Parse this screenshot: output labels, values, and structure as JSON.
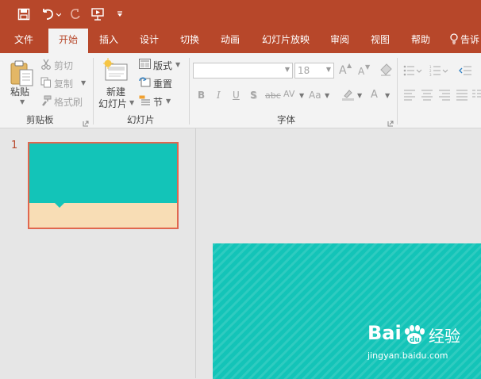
{
  "qat": {
    "save_icon": "save-icon",
    "undo_icon": "undo-icon",
    "redo_icon": "redo-icon",
    "present_icon": "start-slideshow-icon",
    "customize_icon": "customize-qat-icon"
  },
  "tabs": [
    {
      "label": "文件",
      "active": false
    },
    {
      "label": "开始",
      "active": true
    },
    {
      "label": "插入",
      "active": false
    },
    {
      "label": "设计",
      "active": false
    },
    {
      "label": "切换",
      "active": false
    },
    {
      "label": "动画",
      "active": false
    },
    {
      "label": "幻灯片放映",
      "active": false
    },
    {
      "label": "审阅",
      "active": false
    },
    {
      "label": "视图",
      "active": false
    },
    {
      "label": "帮助",
      "active": false
    }
  ],
  "tell_me": "告诉",
  "ribbon": {
    "clipboard": {
      "paste": "粘贴",
      "cut": "剪切",
      "copy": "复制",
      "format_painter": "格式刷",
      "group_label": "剪贴板"
    },
    "slides": {
      "new_slide_line1": "新建",
      "new_slide_line2": "幻灯片",
      "layout": "版式",
      "reset": "重置",
      "section": "节",
      "group_label": "幻灯片"
    },
    "font": {
      "font_name": "",
      "font_size": "18",
      "bold": "B",
      "italic": "I",
      "underline": "U",
      "shadow": "S",
      "strikethrough": "abc",
      "char_spacing": "AV",
      "change_case": "Aa",
      "font_color": "A",
      "grow": "A",
      "shrink": "A",
      "group_label": "字体"
    }
  },
  "slide_panel": {
    "slide_number": "1"
  },
  "watermark": {
    "line1": "Bai",
    "line2": "经验",
    "url": "jingyan.baidu.com"
  },
  "colors": {
    "brand": "#b7472a",
    "teal": "#13c4b8",
    "sand": "#f8ddb5",
    "selection": "#e0674f"
  }
}
